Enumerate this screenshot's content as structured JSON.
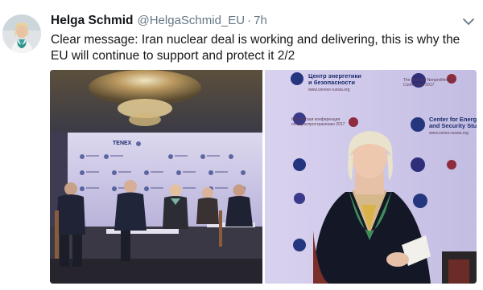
{
  "tweet": {
    "author_name": "Helga Schmid",
    "author_handle": "@HelgaSchmid_EU",
    "separator": "·",
    "timestamp": "7h",
    "text": "Clear message: Iran nuclear deal is working and delivering, this is why the EU will continue to support and protect it 2/2"
  },
  "icons": {
    "avatar": "profile-avatar",
    "menu": "chevron-down-icon"
  },
  "media": {
    "left_photo": {
      "banner_label": "TENEX"
    },
    "right_photo": {
      "banner_1_line1": "Центр энергетики",
      "banner_1_line2": "и безопасности",
      "banner_1_url": "www.ceness-russia.org",
      "banner_2_line1": "The Moscow Nonproliferation",
      "banner_2_line2": "Conference 2017",
      "banner_3_line1": "Московская конференция",
      "banner_3_line2": "по нераспространению 2017",
      "banner_4_line1": "Center for Energy",
      "banner_4_line2": "and Security Studies",
      "banner_4_url": "www.cenes-russia.org"
    }
  },
  "colors": {
    "text_primary": "#14171a",
    "text_secondary": "#657786",
    "stage_backdrop": "#c7c2e4",
    "logo_blue": "#1b2b6b"
  }
}
